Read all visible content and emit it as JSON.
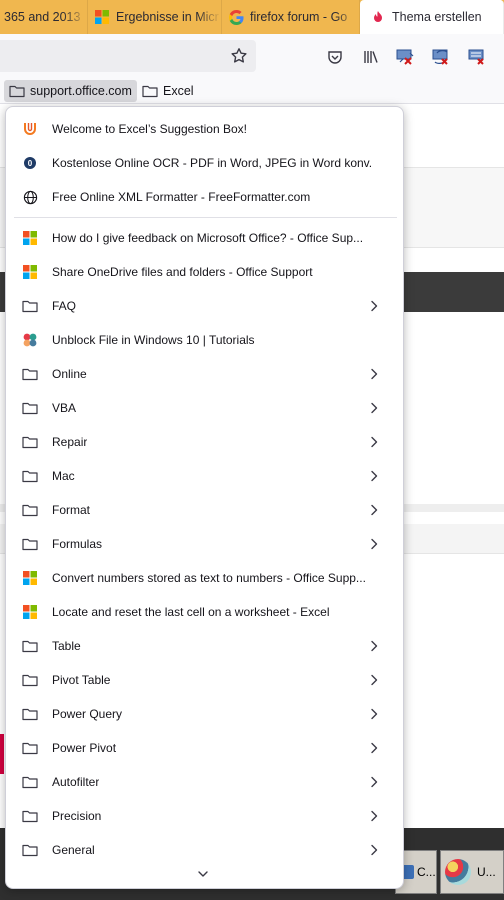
{
  "tabs": [
    {
      "label": "365 and 2013",
      "icon": "none",
      "active": false
    },
    {
      "label": "Ergebnisse in Micr",
      "icon": "ms-logo-icon",
      "active": false
    },
    {
      "label": "firefox forum - Go",
      "icon": "google-icon",
      "active": false
    },
    {
      "label": "Thema erstellen",
      "icon": "flame-icon",
      "active": true
    }
  ],
  "bookmarks_toolbar": [
    {
      "label": "support.office.com",
      "icon": "folder-icon",
      "open": true
    },
    {
      "label": "Excel",
      "icon": "folder-icon",
      "open": false
    }
  ],
  "menu": {
    "items": [
      {
        "label": "Welcome to Excel’s Suggestion Box!",
        "icon": "uservoice-icon",
        "submenu": false
      },
      {
        "label": "Kostenlose Online OCR - PDF in Word, JPEG in Word konv...",
        "icon": "ocr-icon",
        "submenu": false
      },
      {
        "label": "Free Online XML Formatter - FreeFormatter.com",
        "icon": "globe-icon",
        "submenu": false
      },
      {
        "label": "How do I give feedback on Microsoft Office? - Office Sup...",
        "icon": "ms-logo-icon",
        "submenu": false
      },
      {
        "label": "Share OneDrive files and folders - Office Support",
        "icon": "ms-logo-icon",
        "submenu": false
      },
      {
        "label": "FAQ",
        "icon": "folder-icon",
        "submenu": true
      },
      {
        "label": "Unblock File in Windows 10 | Tutorials",
        "icon": "tenforums-icon",
        "submenu": false
      },
      {
        "label": "Online",
        "icon": "folder-icon",
        "submenu": true
      },
      {
        "label": "VBA",
        "icon": "folder-icon",
        "submenu": true
      },
      {
        "label": "Repair",
        "icon": "folder-icon",
        "submenu": true
      },
      {
        "label": "Mac",
        "icon": "folder-icon",
        "submenu": true
      },
      {
        "label": "Format",
        "icon": "folder-icon",
        "submenu": true
      },
      {
        "label": "Formulas",
        "icon": "folder-icon",
        "submenu": true
      },
      {
        "label": "Convert numbers stored as text to numbers - Office Supp...",
        "icon": "ms-logo-icon",
        "submenu": false
      },
      {
        "label": "Locate and reset the last cell on a worksheet - Excel",
        "icon": "ms-logo-icon",
        "submenu": false
      },
      {
        "label": "Table",
        "icon": "folder-icon",
        "submenu": true
      },
      {
        "label": "Pivot Table",
        "icon": "folder-icon",
        "submenu": true
      },
      {
        "label": "Power Query",
        "icon": "folder-icon",
        "submenu": true
      },
      {
        "label": "Power Pivot",
        "icon": "folder-icon",
        "submenu": true
      },
      {
        "label": "Autofilter",
        "icon": "folder-icon",
        "submenu": true
      },
      {
        "label": "Precision",
        "icon": "folder-icon",
        "submenu": true
      },
      {
        "label": "General",
        "icon": "folder-icon",
        "submenu": true
      }
    ]
  },
  "taskbar": [
    {
      "label": "C..."
    },
    {
      "label": "U..."
    }
  ],
  "colors": {
    "tabstrip": "#f0b74f",
    "active_tab": "#ffffff",
    "toolbar": "#f9f9fb",
    "menu_bg": "#ffffff"
  }
}
